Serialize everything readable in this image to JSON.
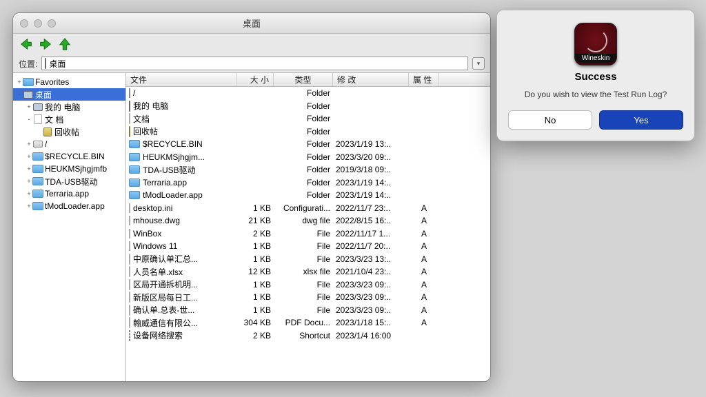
{
  "window": {
    "title": "桌面"
  },
  "location": {
    "label": "位置:",
    "path": "桌面"
  },
  "tree": [
    {
      "depth": 0,
      "tw": "+",
      "icon": "folder",
      "label": "Favorites"
    },
    {
      "depth": 0,
      "tw": "-",
      "icon": "monitor",
      "label": "桌面",
      "selected": true
    },
    {
      "depth": 1,
      "tw": "+",
      "icon": "monitor",
      "label": "我的 电脑"
    },
    {
      "depth": 1,
      "tw": "-",
      "icon": "doc",
      "label": "文 档"
    },
    {
      "depth": 2,
      "tw": "",
      "icon": "trash",
      "label": "回收帖"
    },
    {
      "depth": 1,
      "tw": "+",
      "icon": "drive",
      "label": "/"
    },
    {
      "depth": 1,
      "tw": "+",
      "icon": "folder",
      "label": "$RECYCLE.BIN"
    },
    {
      "depth": 1,
      "tw": "+",
      "icon": "folder",
      "label": "HEUKMSjhgjmfb"
    },
    {
      "depth": 1,
      "tw": "+",
      "icon": "folder",
      "label": "TDA-USB驱动"
    },
    {
      "depth": 1,
      "tw": "+",
      "icon": "folder",
      "label": "Terraria.app"
    },
    {
      "depth": 1,
      "tw": "+",
      "icon": "folder",
      "label": "tModLoader.app"
    }
  ],
  "columns": {
    "file": "文件",
    "size": "大 小",
    "type": "类型",
    "modified": "修 改",
    "attr": "属 性"
  },
  "files": [
    {
      "icon": "drive",
      "name": "/",
      "size": "",
      "type": "Folder",
      "mod": "",
      "attr": ""
    },
    {
      "icon": "monitor",
      "name": "我的 电脑",
      "size": "",
      "type": "Folder",
      "mod": "",
      "attr": ""
    },
    {
      "icon": "doc",
      "name": "文档",
      "size": "",
      "type": "Folder",
      "mod": "",
      "attr": ""
    },
    {
      "icon": "trash",
      "name": "回收帖",
      "size": "",
      "type": "Folder",
      "mod": "",
      "attr": ""
    },
    {
      "icon": "folder",
      "name": "$RECYCLE.BIN",
      "size": "",
      "type": "Folder",
      "mod": "2023/1/19 13:..",
      "attr": ""
    },
    {
      "icon": "folder",
      "name": "HEUKMSjhgjm...",
      "size": "",
      "type": "Folder",
      "mod": "2023/3/20 09:..",
      "attr": ""
    },
    {
      "icon": "folder",
      "name": "TDA-USB驱动",
      "size": "",
      "type": "Folder",
      "mod": "2019/3/18 09:..",
      "attr": ""
    },
    {
      "icon": "folder",
      "name": "Terraria.app",
      "size": "",
      "type": "Folder",
      "mod": "2023/1/19 14:..",
      "attr": ""
    },
    {
      "icon": "folder",
      "name": "tModLoader.app",
      "size": "",
      "type": "Folder",
      "mod": "2023/1/19 14:..",
      "attr": ""
    },
    {
      "icon": "doc",
      "name": "desktop.ini",
      "size": "1 KB",
      "type": "Configurati...",
      "mod": "2022/11/7 23:..",
      "attr": "A"
    },
    {
      "icon": "doc",
      "name": "mhouse.dwg",
      "size": "21 KB",
      "type": "dwg file",
      "mod": "2022/8/15 16:..",
      "attr": "A"
    },
    {
      "icon": "doc",
      "name": "WinBox",
      "size": "2 KB",
      "type": "File",
      "mod": "2022/11/17 1...",
      "attr": "A"
    },
    {
      "icon": "doc",
      "name": "Windows 11",
      "size": "1 KB",
      "type": "File",
      "mod": "2022/11/7 20:..",
      "attr": "A"
    },
    {
      "icon": "doc",
      "name": "中原确认单汇总...",
      "size": "1 KB",
      "type": "File",
      "mod": "2023/3/23 13:..",
      "attr": "A"
    },
    {
      "icon": "doc",
      "name": "人员名单.xlsx",
      "size": "12 KB",
      "type": "xlsx file",
      "mod": "2021/10/4 23:..",
      "attr": "A"
    },
    {
      "icon": "doc",
      "name": "区局开通拆机明...",
      "size": "1 KB",
      "type": "File",
      "mod": "2023/3/23 09:..",
      "attr": "A"
    },
    {
      "icon": "doc",
      "name": "新版区局每日工...",
      "size": "1 KB",
      "type": "File",
      "mod": "2023/3/23 09:..",
      "attr": "A"
    },
    {
      "icon": "doc",
      "name": "确认单.总表-世...",
      "size": "1 KB",
      "type": "File",
      "mod": "2023/3/23 09:..",
      "attr": "A"
    },
    {
      "icon": "doc",
      "name": "翰威通信有限公...",
      "size": "304 KB",
      "type": "PDF Docu...",
      "mod": "2023/1/18 15:..",
      "attr": "A"
    },
    {
      "icon": "shortcut",
      "name": "设备网络搜索",
      "size": "2 KB",
      "type": "Shortcut",
      "mod": "2023/1/4 16:00",
      "attr": ""
    }
  ],
  "dialog": {
    "brand": "Wineskin",
    "title": "Success",
    "message": "Do you wish to view the Test Run Log?",
    "no": "No",
    "yes": "Yes"
  }
}
